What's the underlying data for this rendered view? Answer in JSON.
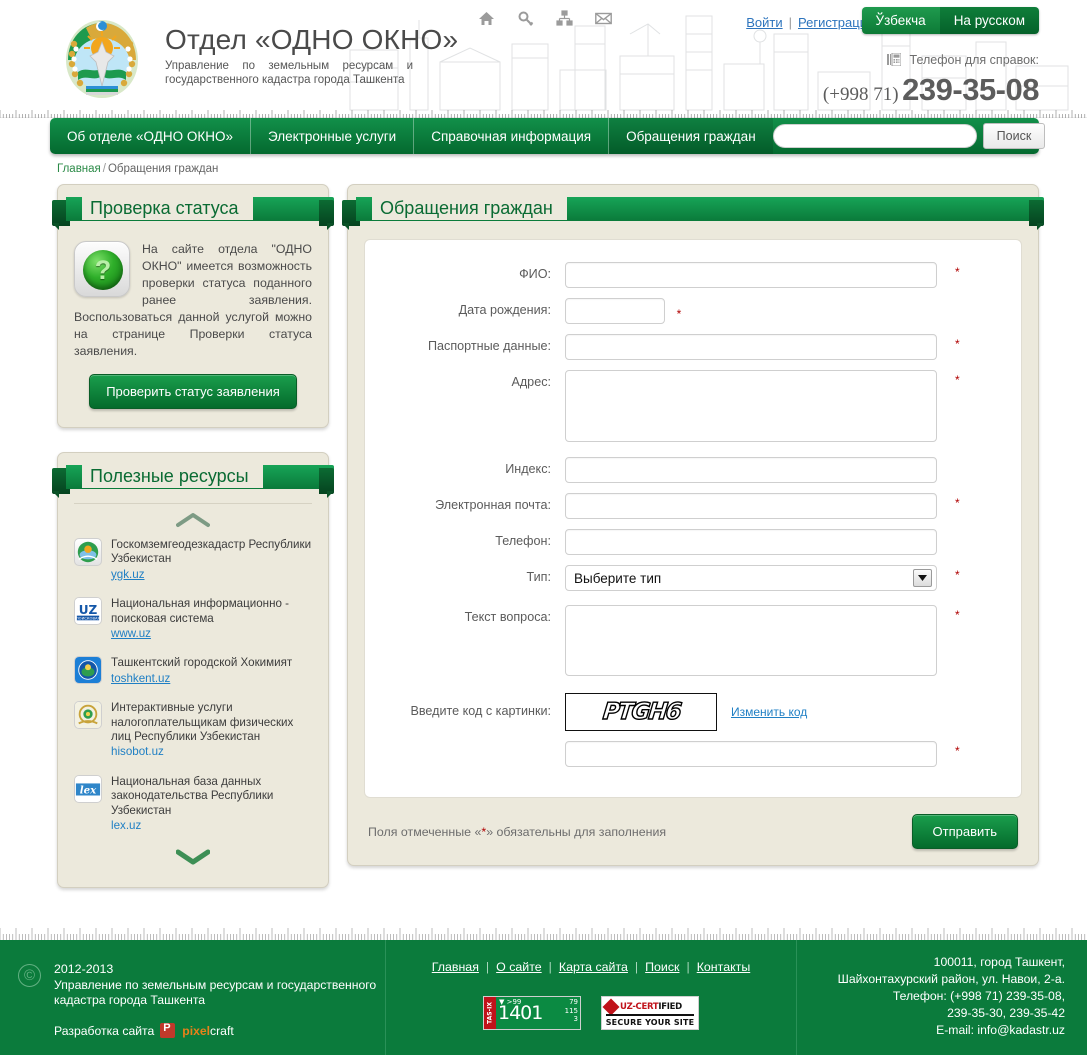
{
  "header": {
    "title": "Отдел «ОДНО ОКНО»",
    "subtitle": "Управление по земельным ресурсам и государственного кадастра города Ташкента",
    "emblem_name": "uzbekistan-coat-of-arms",
    "icons": [
      "home-icon",
      "key-icon",
      "sitemap-icon",
      "envelope-icon"
    ],
    "login_label": "Войти",
    "register_label": "Регистрация",
    "separator": "|",
    "lang_uz": "Ўзбекча",
    "lang_ru": "На русском",
    "phone_label": "Телефон для справок:",
    "phone_code": "(+998 71)",
    "phone_number": "239-35-08"
  },
  "nav": {
    "items": [
      {
        "label": "Об отделе «ОДНО ОКНО»",
        "active": false
      },
      {
        "label": "Электронные услуги",
        "active": false
      },
      {
        "label": "Справочная информация",
        "active": false
      },
      {
        "label": "Обращения граждан",
        "active": true
      }
    ],
    "search_value": "",
    "search_placeholder": "",
    "search_button": "Поиск"
  },
  "breadcrumb": {
    "home": "Главная",
    "slash": "/",
    "current": "Обращения граждан"
  },
  "sidebar": {
    "status_panel": {
      "title": "Проверка статуса",
      "icon_name": "green-question-ball-icon",
      "icon_glyph": "?",
      "text": "На сайте отдела \"ОДНО ОКНО\" имеется возможность проверки статуса поданного ранее заявления. Воспользоваться данной услугой можно на странице Проверки статуса заявления.",
      "button": "Проверить статус заявления"
    },
    "resources_panel": {
      "title": "Полезные ресурсы",
      "scroll_up": "chevron-up-icon",
      "scroll_down": "chevron-down-icon",
      "items": [
        {
          "name": "Госкомземгеодезкадастр Республики Узбекистан",
          "link": "ygk.uz",
          "icon": "ygk-logo-icon"
        },
        {
          "name": "Национальная информационно - поисковая система",
          "link": "www.uz",
          "icon": "uz-logo-icon"
        },
        {
          "name": "Ташкентский городской Хокимият",
          "link": "toshkent.uz",
          "icon": "toshkent-logo-icon"
        },
        {
          "name": "Интерактивные услуги налогоплательщикам физических лиц Республики Узбекистан",
          "link": "hisobot.uz",
          "icon": "hisobot-logo-icon"
        },
        {
          "name": "Национальная база данных законодательства Республики Узбекистан",
          "link": "lex.uz",
          "icon": "lex-logo-icon"
        }
      ]
    }
  },
  "main": {
    "title": "Обращения граждан",
    "fields": {
      "fio": {
        "label": "ФИО:",
        "value": "",
        "required": true
      },
      "birth": {
        "label": "Дата рождения:",
        "value": "",
        "required": true
      },
      "passport": {
        "label": "Паспортные данные:",
        "value": "",
        "required": true
      },
      "address": {
        "label": "Адрес:",
        "value": "",
        "required": true
      },
      "index": {
        "label": "Индекс:",
        "value": "",
        "required": false
      },
      "email": {
        "label": "Электронная почта:",
        "value": "",
        "required": true
      },
      "phone": {
        "label": "Телефон:",
        "value": "",
        "required": false
      },
      "type": {
        "label": "Тип:",
        "value": "Выберите тип",
        "required": true
      },
      "question": {
        "label": "Текст вопроса:",
        "value": "",
        "required": true
      },
      "captcha": {
        "label": "Введите код с картинки:",
        "image_text": "PTGH6",
        "refresh_link": "Изменить код",
        "value": "",
        "required": true
      }
    },
    "required_note_prefix": "Поля отмеченные «",
    "required_note_star": "*",
    "required_note_suffix": "» обязательны для заполнения",
    "submit_label": "Отправить"
  },
  "footer": {
    "copyright_symbol": "©",
    "years": "2012-2013",
    "org": "Управление по земельным ресурсам и государственного кадастра города Ташкента",
    "dev_label": "Разработка сайта",
    "dev_brand_a": "pixel",
    "dev_brand_b": "craft",
    "nav": [
      "Главная",
      "О сайте",
      "Карта сайта",
      "Поиск",
      "Контакты"
    ],
    "nav_sep": "|",
    "counter": {
      "label": "TAS-IX",
      "top": "▼ >99",
      "value": "1401",
      "s1": "79",
      "s2": "115",
      "s3": "3"
    },
    "certbadge": {
      "line1_a": "UZ-CERT",
      "line1_b": "IFIED",
      "line2": "SECURE YOUR SITE"
    },
    "address_lines": [
      "100011, город Ташкент,",
      "Шайхонтахурский район, ул. Навои, 2-а.",
      "Телефон: (+998 71) 239-35-08,",
      "239-35-30, 239-35-42",
      "E-mail: info@kadastr.uz"
    ]
  },
  "colors": {
    "brand_green": "#0b7b3c",
    "dark_green": "#05431f",
    "panel_bg": "#ece9dc",
    "link_blue": "#1f7fc4",
    "required_red": "#b00000"
  }
}
